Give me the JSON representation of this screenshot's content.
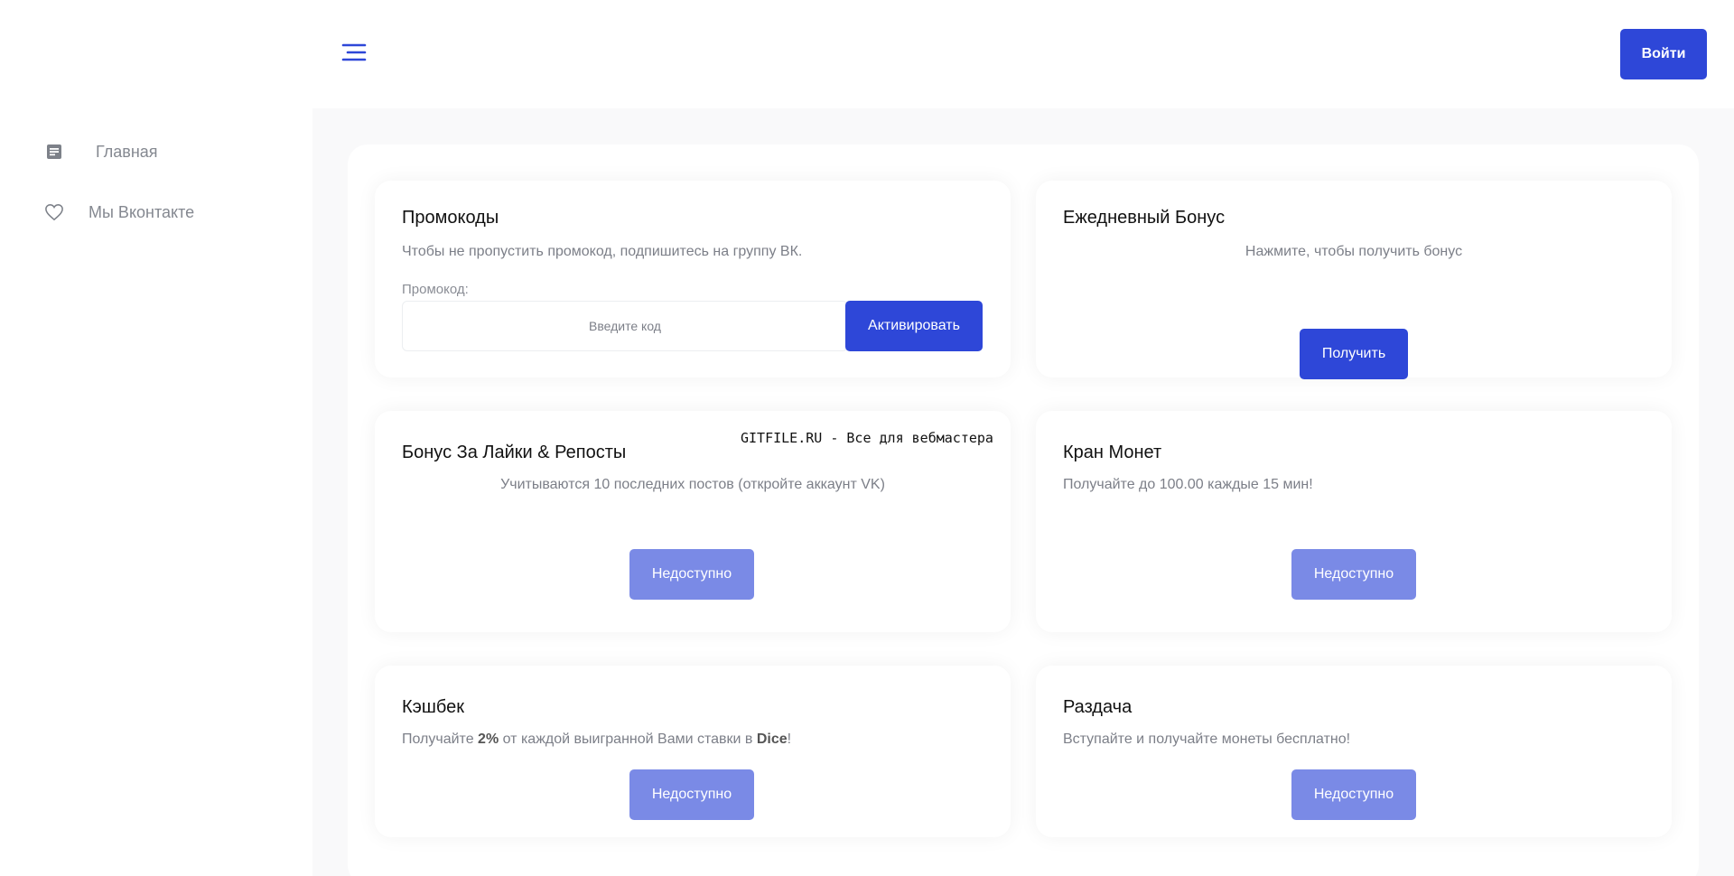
{
  "sidebar": {
    "items": [
      {
        "label": "Главная",
        "icon": "document-icon"
      },
      {
        "label": "Мы Вконтакте",
        "icon": "heart-icon"
      }
    ]
  },
  "header": {
    "menu_icon": "menu-icon",
    "login_label": "Войти"
  },
  "colors": {
    "accent": "#2e47d8",
    "accent_disabled": "#7a8ae6"
  },
  "cards": {
    "promo": {
      "title": "Промокоды",
      "subtitle": "Чтобы не пропустить промокод, подпишитесь на группу ВК.",
      "field_label": "Промокод:",
      "placeholder": "Введите код",
      "value": "",
      "button": "Активировать"
    },
    "daily": {
      "title": "Ежедневный Бонус",
      "subtitle": "Нажмите, чтобы получить бонус",
      "button": "Получить"
    },
    "likes": {
      "title": "Бонус За Лайки & Репосты",
      "subtitle": "Учитываются 10 последних постов (откройте аккаунт VK)",
      "button": "Недоступно"
    },
    "faucet": {
      "title": "Кран Монет",
      "subtitle": "Получайте до 100.00 каждые 15 мин!",
      "button": "Недоступно"
    },
    "cashback": {
      "title": "Кэшбек",
      "subtitle_prefix": "Получайте ",
      "subtitle_percent": "2%",
      "subtitle_middle": " от каждой выигранной Вами ставки в ",
      "subtitle_game": "Dice",
      "subtitle_suffix": "!",
      "button": "Недоступно"
    },
    "giveaway": {
      "title": "Раздача",
      "subtitle": "Вступайте и получайте монеты бесплатно!",
      "button": "Недоступно"
    }
  },
  "watermark": "GITFILE.RU - Все для вебмастера"
}
